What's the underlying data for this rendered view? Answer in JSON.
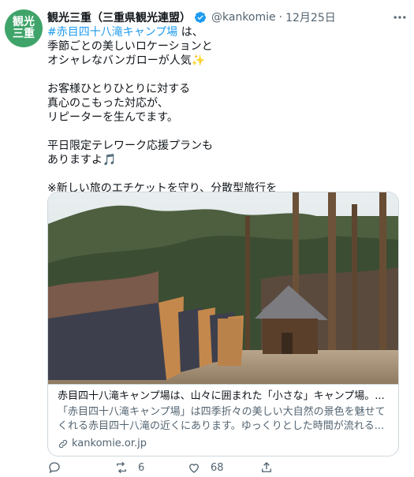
{
  "avatar": {
    "line1": "観光",
    "line2": "三重"
  },
  "tweet": {
    "author_name": "観光三重（三重県観光連盟）",
    "handle": "@kankomie",
    "date": "12月25日",
    "lines": [
      {
        "text": "#赤目四十八滝キャンプ場 は、",
        "hashtag": "#赤目四十八滝キャンプ場",
        "rest": " は、"
      },
      {
        "text": "季節ごとの美しいロケーションと"
      },
      {
        "text": "オシャレなバンガローが人気✨"
      },
      {
        "text": ""
      },
      {
        "text": "お客様ひとりひとりに対する"
      },
      {
        "text": "真心のこもった対応が、"
      },
      {
        "text": "リピーターを生んでます。"
      },
      {
        "text": ""
      },
      {
        "text": "平日限定テレワーク応援プランも"
      },
      {
        "text": "ありますよ🎵"
      },
      {
        "text": ""
      },
      {
        "text": "※新しい旅のエチケットを守り、分散型旅行を"
      }
    ]
  },
  "card": {
    "title": "赤目四十八滝キャンプ場は、山々に囲まれた「小さな」キャンプ場。...",
    "description": "「赤目四十八滝キャンプ場」は四季折々の美しい大自然の景色を魅せてくれる赤目四十八滝の近くにあります。ゆっくりとした時間が流れる...",
    "domain": "kankomie.or.jp"
  },
  "actions": {
    "replies": "",
    "retweets": "6",
    "likes": "68"
  },
  "colors": {
    "accent": "#1d9bf0",
    "muted": "#536471",
    "avatar": "#3fa46a"
  }
}
